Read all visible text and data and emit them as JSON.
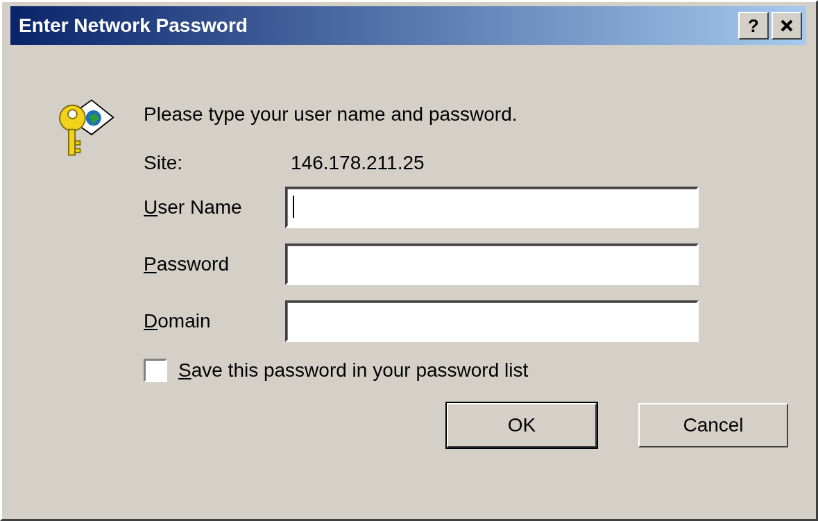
{
  "window": {
    "title": "Enter Network Password",
    "controls": [
      {
        "kind": "help",
        "label": "?"
      },
      {
        "kind": "close"
      }
    ]
  },
  "prompt": "Please type your user name and password.",
  "site": {
    "label": "Site:",
    "value": "146.178.211.25"
  },
  "fields": [
    {
      "label": "User Name",
      "mnemonic": true,
      "focused": true
    },
    {
      "label": "Password",
      "mnemonic": true,
      "focused": false
    },
    {
      "label": "Domain",
      "mnemonic": true,
      "focused": false
    }
  ],
  "save_password": {
    "label": "Save this password in your password list",
    "mnemonic": true,
    "checked": false
  },
  "buttons": [
    {
      "label": "OK",
      "default": true
    },
    {
      "label": "Cancel",
      "default": false
    }
  ]
}
